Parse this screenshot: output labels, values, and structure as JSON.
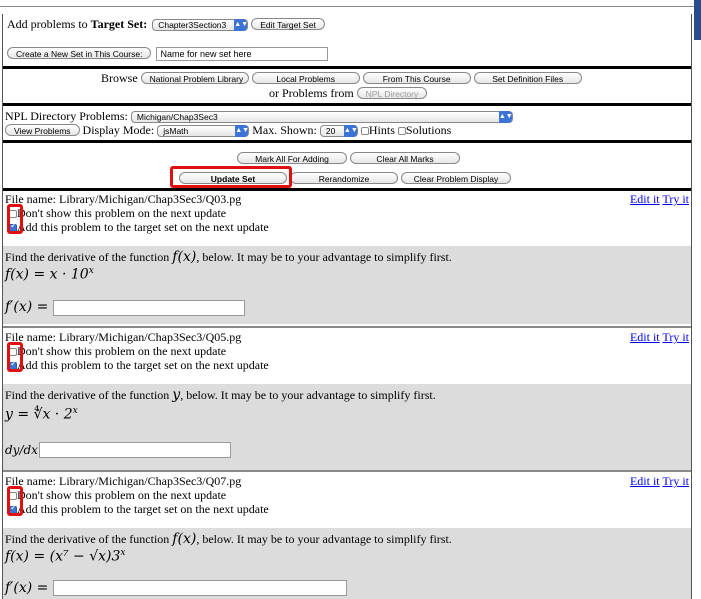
{
  "header": {
    "add_prefix": "Add problems to ",
    "target_label": "Target Set:",
    "target_value": "Chapter3Section3",
    "edit_target_button": "Edit Target Set",
    "create_set_button": "Create a New Set in This Course:",
    "new_set_value": "Name for new set here"
  },
  "browse": {
    "label": "Browse",
    "buttons": [
      "National Problem Library",
      "Local Problems",
      "From This Course",
      "Set Definition Files"
    ],
    "or_label": "or Problems from",
    "npl_directory_button": "NPL Directory"
  },
  "npl": {
    "label": "NPL Directory Problems:",
    "directory_value": "Michigan/Chap3Sec3",
    "view_button": "View Problems",
    "display_mode_label": "Display Mode:",
    "display_mode_value": "jsMath",
    "max_shown_label": "Max. Shown:",
    "max_shown_value": "20",
    "hints_label": "Hints",
    "solutions_label": "Solutions"
  },
  "actions": {
    "mark_all": "Mark All For Adding",
    "clear_all": "Clear All Marks",
    "update_set": "Update Set",
    "rerandomize": "Rerandomize",
    "clear_display": "Clear Problem Display"
  },
  "problems": [
    {
      "file": "File name: Library/Michigan/Chap3Sec3/Q03.pg",
      "edit": "Edit it",
      "try": "Try it",
      "dont_show": "Don't show this problem on the next update",
      "add": "Add this problem to the target set on the next update",
      "statement_a": "Find the derivative of the function ",
      "statement_var": "f(x)",
      "statement_b": ", below. It may be to your advantage to simplify first.",
      "formula": "f(x) = x · 10",
      "formula_sup": "x",
      "answer_label": "f′(x) ="
    },
    {
      "file": "File name: Library/Michigan/Chap3Sec3/Q05.pg",
      "edit": "Edit it",
      "try": "Try it",
      "dont_show": "Don't show this problem on the next update",
      "add": "Add this problem to the target set on the next update",
      "statement_a": "Find the derivative of the function ",
      "statement_var": "y",
      "statement_b": ", below. It may be to your advantage to simplify first.",
      "formula": "y = ∜x · 2",
      "formula_sup": "x",
      "answer_label": "dy/dx ="
    },
    {
      "file": "File name: Library/Michigan/Chap3Sec3/Q07.pg",
      "edit": "Edit it",
      "try": "Try it",
      "dont_show": "Don't show this problem on the next update",
      "add": "Add this problem to the target set on the next update",
      "statement_a": "Find the derivative of the function ",
      "statement_var": "f(x)",
      "statement_b": ", below. It may be to your advantage to simplify first.",
      "formula": "f(x) = (x⁷ − √x)3",
      "formula_sup": "x",
      "answer_label": "f′(x) ="
    }
  ]
}
